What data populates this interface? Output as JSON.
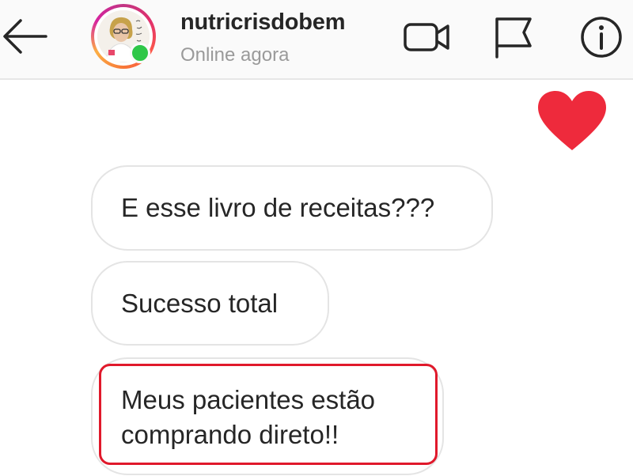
{
  "header": {
    "username": "nutricrisdobem",
    "status": "Online agora",
    "icons": {
      "back": "arrow-left-icon",
      "video": "video-camera-icon",
      "flag": "flag-icon",
      "info": "info-icon"
    }
  },
  "messages": [
    {
      "type": "reaction",
      "icon": "heart-icon",
      "color": "#ee2a3c",
      "side": "right"
    },
    {
      "type": "text",
      "side": "left",
      "text": "E esse livro de receitas???"
    },
    {
      "type": "text",
      "side": "left",
      "text": "Sucesso total"
    },
    {
      "type": "text",
      "side": "left",
      "text": "Meus pacientes estão comprando direto!!",
      "highlighted": true,
      "highlight_color": "#e0192b"
    }
  ],
  "colors": {
    "online_dot": "#2ec748",
    "story_ring": "#e1306c"
  }
}
